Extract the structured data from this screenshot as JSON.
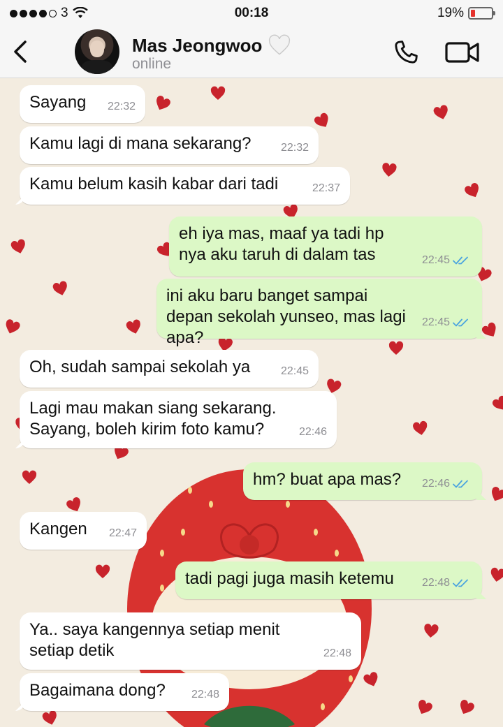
{
  "status_bar": {
    "carrier": "3",
    "time": "00:18",
    "battery": "19%"
  },
  "header": {
    "contact_name": "Mas Jeongwoo",
    "status": "online"
  },
  "colors": {
    "incoming_bubble": "#ffffff",
    "outgoing_bubble": "#dcf8c6",
    "read_ticks": "#4aa3df",
    "battery_low": "#e4312c"
  },
  "messages": [
    {
      "dir": "in",
      "text": "Sayang",
      "time": "22:32"
    },
    {
      "dir": "in",
      "text": "Kamu lagi di mana sekarang?",
      "time": "22:32"
    },
    {
      "dir": "in",
      "text": "Kamu belum kasih kabar dari tadi",
      "time": "22:37"
    },
    {
      "dir": "out",
      "text": "eh iya mas, maaf ya tadi hp nya aku taruh di dalam tas",
      "time": "22:45",
      "read": true
    },
    {
      "dir": "out",
      "text": "ini aku baru banget sampai depan sekolah yunseo, mas lagi apa?",
      "time": "22:45",
      "read": true
    },
    {
      "dir": "in",
      "text": "Oh, sudah sampai sekolah ya",
      "time": "22:45"
    },
    {
      "dir": "in",
      "text": "Lagi mau makan siang sekarang. Sayang, boleh kirim foto kamu?",
      "time": "22:46"
    },
    {
      "dir": "out",
      "text": "hm? buat apa mas?",
      "time": "22:46",
      "read": true
    },
    {
      "dir": "in",
      "text": "Kangen",
      "time": "22:47"
    },
    {
      "dir": "out",
      "text": "tadi pagi juga masih ketemu",
      "time": "22:48",
      "read": true
    },
    {
      "dir": "in",
      "text": "Ya.. saya kangennya setiap menit setiap detik",
      "time": "22:48"
    },
    {
      "dir": "in",
      "text": "Bagaimana dong?",
      "time": "22:48"
    }
  ]
}
